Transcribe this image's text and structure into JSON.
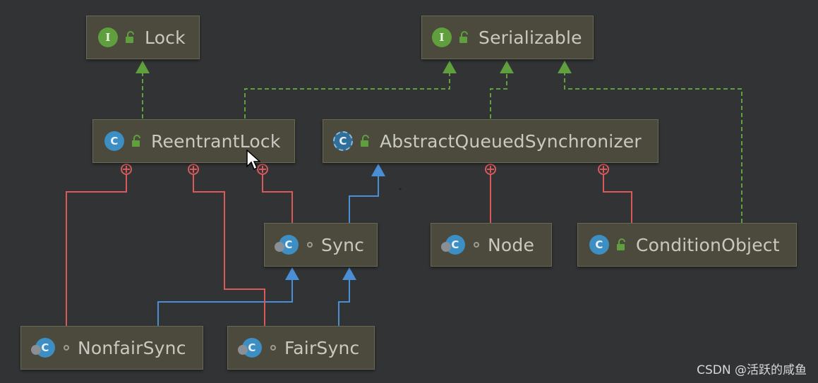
{
  "diagram": {
    "nodes": {
      "lock": {
        "label": "Lock",
        "kind": "interface",
        "badge": "I"
      },
      "serializable": {
        "label": "Serializable",
        "kind": "interface",
        "badge": "I"
      },
      "reentrant_lock": {
        "label": "ReentrantLock",
        "kind": "class",
        "badge": "C"
      },
      "aqs": {
        "label": "AbstractQueuedSynchronizer",
        "kind": "abstract-class",
        "badge": "C"
      },
      "sync": {
        "label": "Sync",
        "kind": "nested-class",
        "badge": "C"
      },
      "node": {
        "label": "Node",
        "kind": "nested-class",
        "badge": "C"
      },
      "condition_object": {
        "label": "ConditionObject",
        "kind": "class",
        "badge": "C"
      },
      "nonfair_sync": {
        "label": "NonfairSync",
        "kind": "nested-class",
        "badge": "C"
      },
      "fair_sync": {
        "label": "FairSync",
        "kind": "nested-class",
        "badge": "C"
      }
    },
    "edges": [
      {
        "from": "ReentrantLock",
        "to": "Lock",
        "type": "implements"
      },
      {
        "from": "ReentrantLock",
        "to": "Serializable",
        "type": "implements"
      },
      {
        "from": "AbstractQueuedSynchronizer",
        "to": "Serializable",
        "type": "implements"
      },
      {
        "from": "ConditionObject",
        "to": "Serializable",
        "type": "implements"
      },
      {
        "from": "Sync",
        "to": "AbstractQueuedSynchronizer",
        "type": "extends"
      },
      {
        "from": "NonfairSync",
        "to": "Sync",
        "type": "extends"
      },
      {
        "from": "FairSync",
        "to": "Sync",
        "type": "extends"
      },
      {
        "from": "Sync",
        "to": "ReentrantLock",
        "type": "inner-class"
      },
      {
        "from": "NonfairSync",
        "to": "ReentrantLock",
        "type": "inner-class"
      },
      {
        "from": "FairSync",
        "to": "ReentrantLock",
        "type": "inner-class"
      },
      {
        "from": "Node",
        "to": "AbstractQueuedSynchronizer",
        "type": "inner-class"
      },
      {
        "from": "ConditionObject",
        "to": "AbstractQueuedSynchronizer",
        "type": "inner-class"
      }
    ]
  },
  "icons": {
    "interface_badge": "interface-icon",
    "class_badge": "class-icon",
    "public_modifier": "unlocked-padlock-icon",
    "package_private_modifier": "circle-dot-icon",
    "mouse_cursor": "cursor-arrow-icon"
  },
  "colors": {
    "background": "#313335",
    "node_fill": "#4b4a3c",
    "implements_line": "#5f9f3e",
    "extends_line": "#4a8fd6",
    "inner_class_line": "#d85a5a",
    "interface_badge": "#5f9f3e",
    "class_badge": "#3d8ec2"
  },
  "watermark": "CSDN @活跃的咸鱼"
}
